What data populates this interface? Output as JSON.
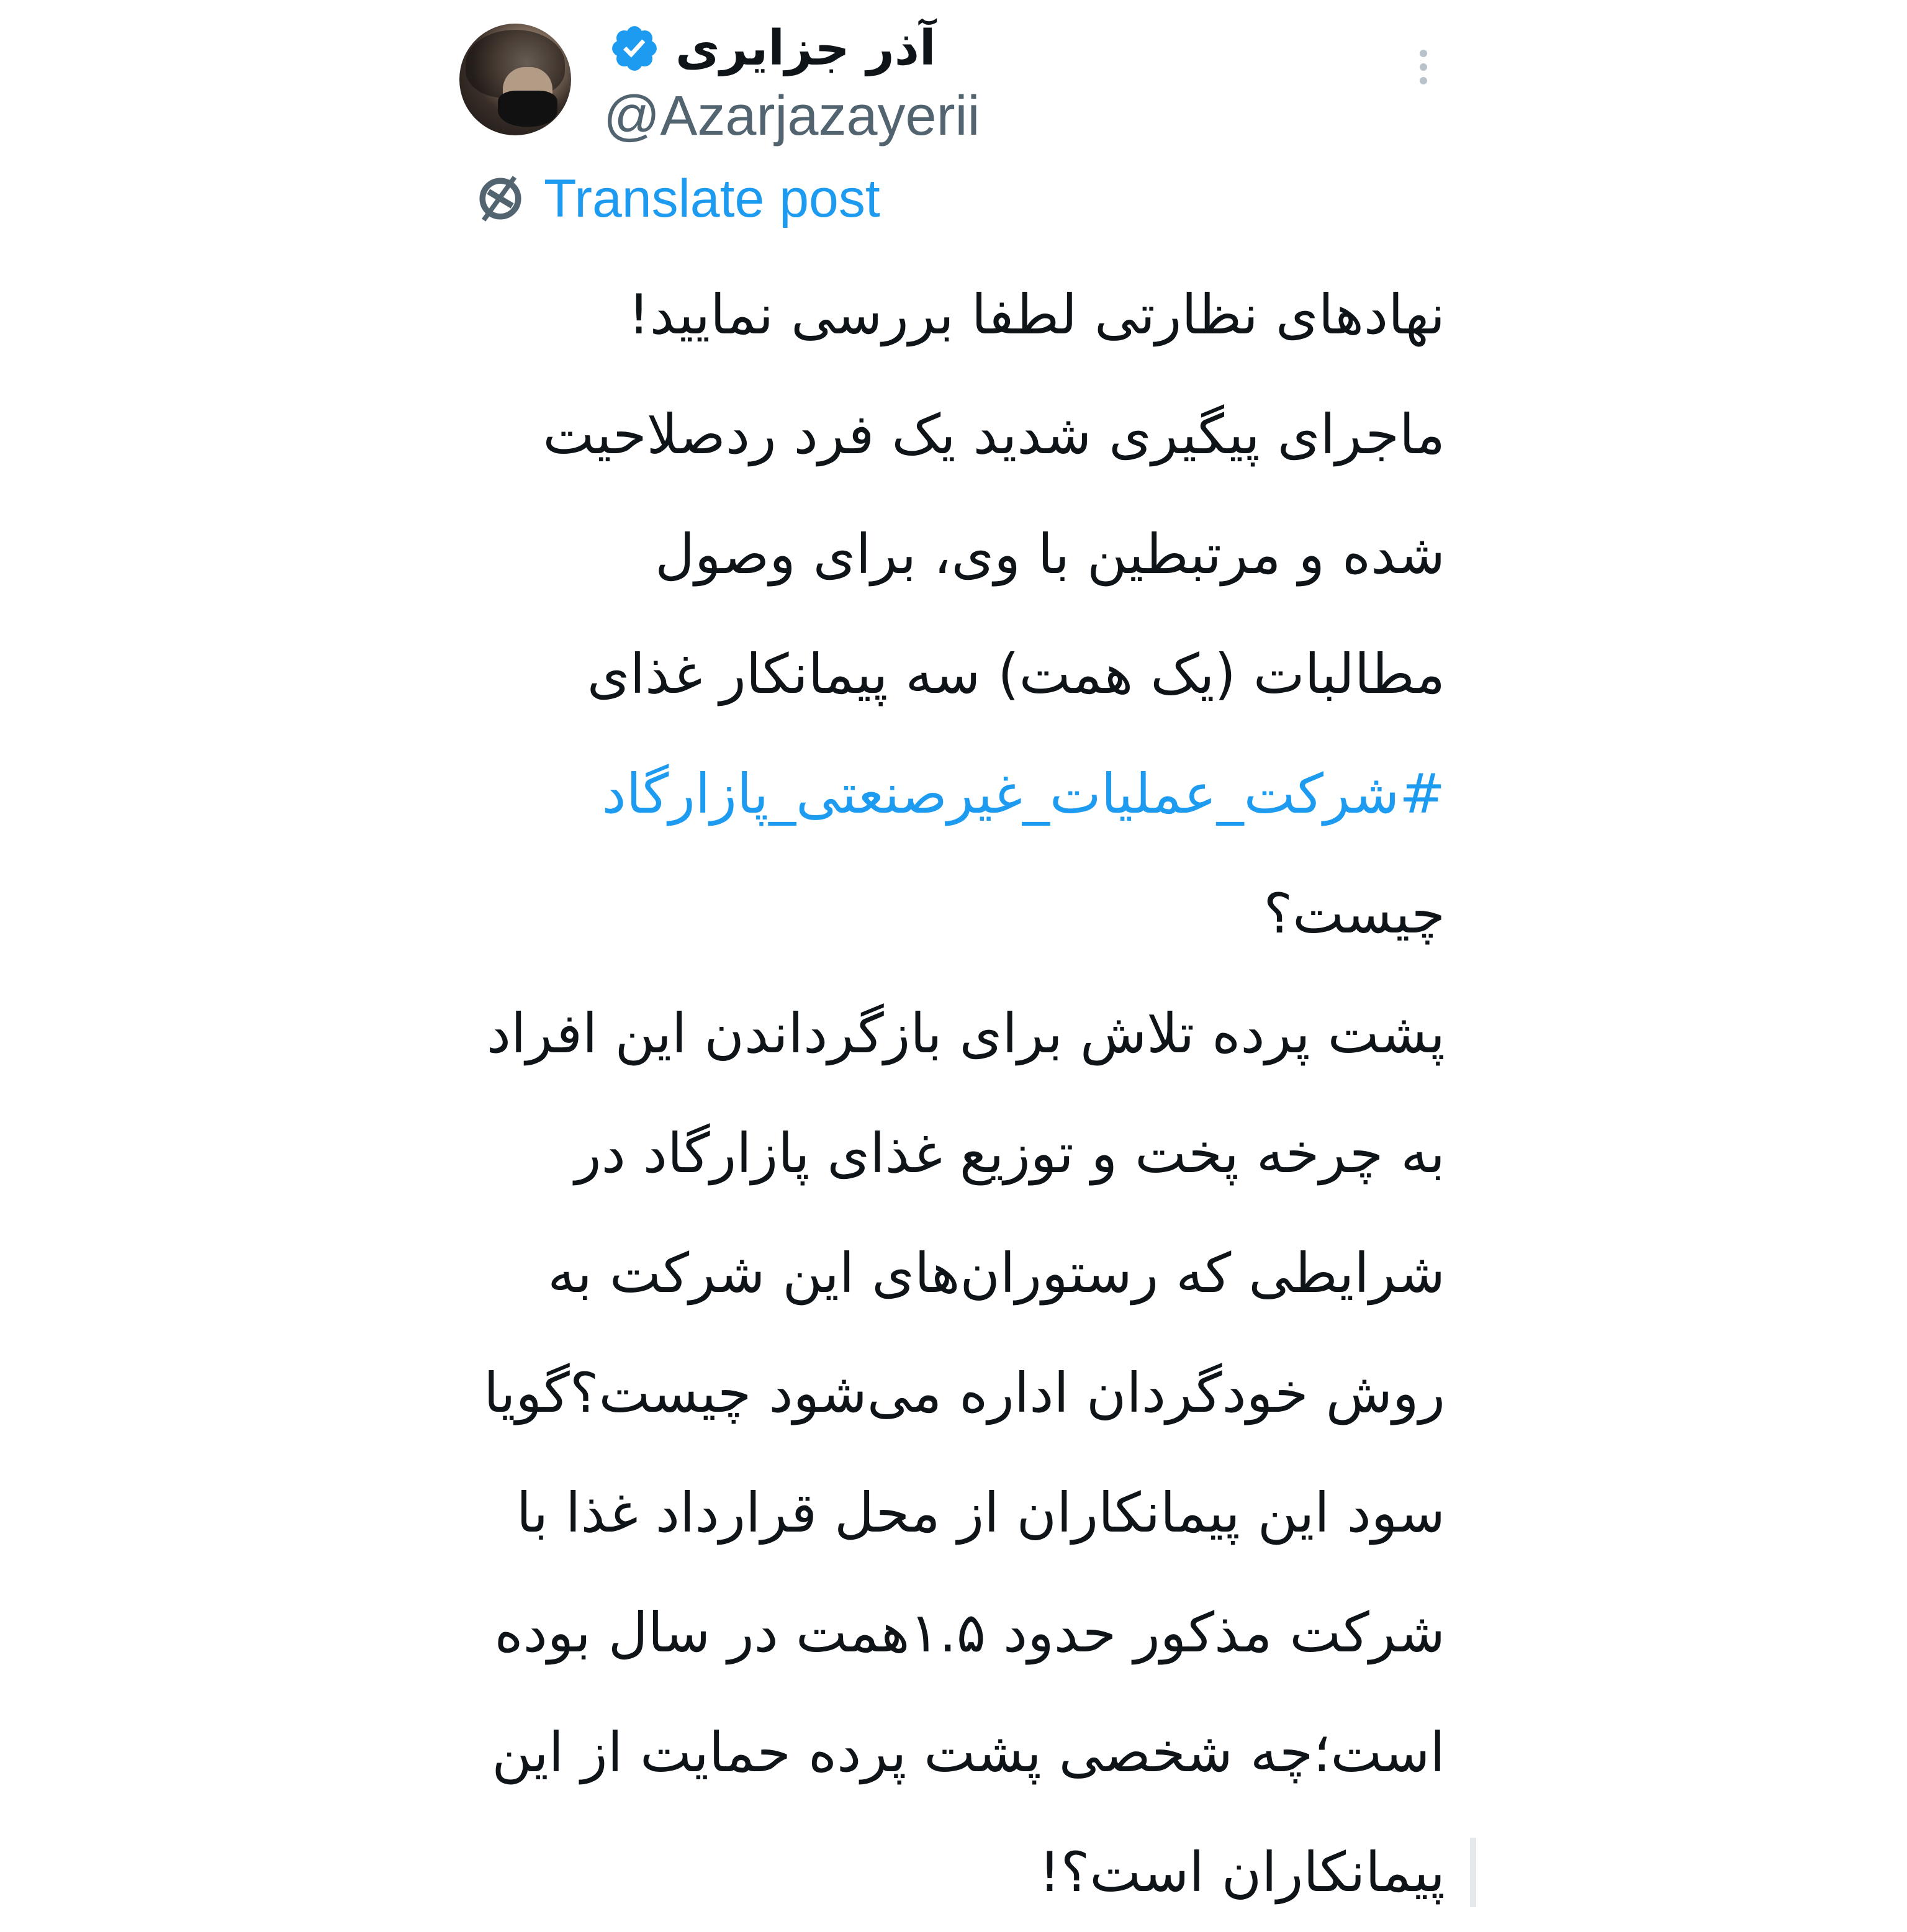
{
  "author": {
    "display_name": "آذر جزایری",
    "handle": "@Azarjazayerii",
    "verified": true
  },
  "actions": {
    "translate_label": "Translate post"
  },
  "post": {
    "lines": [
      "نهادهای نظارتی لطفا بررسی نمایید!",
      "ماجرای پیگیری شدید یک فرد ردصلاحیت",
      "شده و مرتبطین با وی، برای وصول",
      "مطالبات (یک همت) سه پیمانکار غذای",
      "#شرکت_عملیات_غیرصنعتی_پازارگاد",
      "چیست؟",
      "پشت پرده تلاش برای بازگرداندن این افراد",
      "به چرخه پخت و توزیع غذای پازارگاد در",
      "شرایطی که رستوران‌های این شرکت به",
      "روش خودگردان اداره می‌شود چیست؟گویا",
      "سود این پیمانکاران از محل قرارداد غذا با",
      "شرکت مذکور حدود ۱.۵همت در سال بوده",
      "است؛چه شخصی پشت پرده حمایت از این",
      "پیمانکاران است؟!"
    ]
  },
  "colors": {
    "link": "#1d9bf0",
    "text": "#0f1419",
    "secondary": "#536471"
  },
  "icons": {
    "verified": "verified-badge-icon",
    "translate": "translate-globe-icon",
    "more": "more-vertical-icon"
  }
}
